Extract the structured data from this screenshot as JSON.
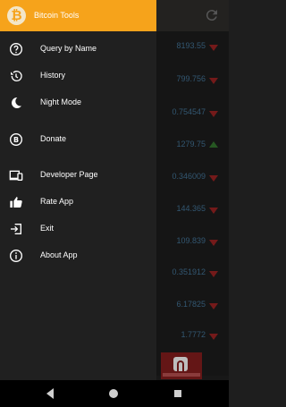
{
  "app": {
    "drawer_title": "Bitcoin Tools",
    "accent_color": "#f6a31b"
  },
  "drawer": {
    "items": [
      {
        "label": "Query by Name",
        "icon": "help-circle-icon"
      },
      {
        "label": "History",
        "icon": "history-icon"
      },
      {
        "label": "Night Mode",
        "icon": "moon-icon"
      },
      {
        "label": "Donate",
        "icon": "bitcoin-icon"
      },
      {
        "label": "Developer Page",
        "icon": "devices-icon"
      },
      {
        "label": "Rate App",
        "icon": "thumb-up-icon"
      },
      {
        "label": "Exit",
        "icon": "exit-icon"
      },
      {
        "label": "About App",
        "icon": "info-icon"
      }
    ]
  },
  "background_list": {
    "rows": [
      {
        "price": "8193.55",
        "trend": "down"
      },
      {
        "price": "799.756",
        "trend": "down"
      },
      {
        "price": "0.754547",
        "trend": "down"
      },
      {
        "price": "1279.75",
        "trend": "up"
      },
      {
        "price": "0.346009",
        "trend": "down"
      },
      {
        "price": "144.365",
        "trend": "down"
      },
      {
        "price": "109.839",
        "trend": "down"
      },
      {
        "price": "0.351912",
        "trend": "down"
      },
      {
        "price": "6.17825",
        "trend": "down"
      },
      {
        "price": "1.7772",
        "trend": "down"
      }
    ]
  }
}
